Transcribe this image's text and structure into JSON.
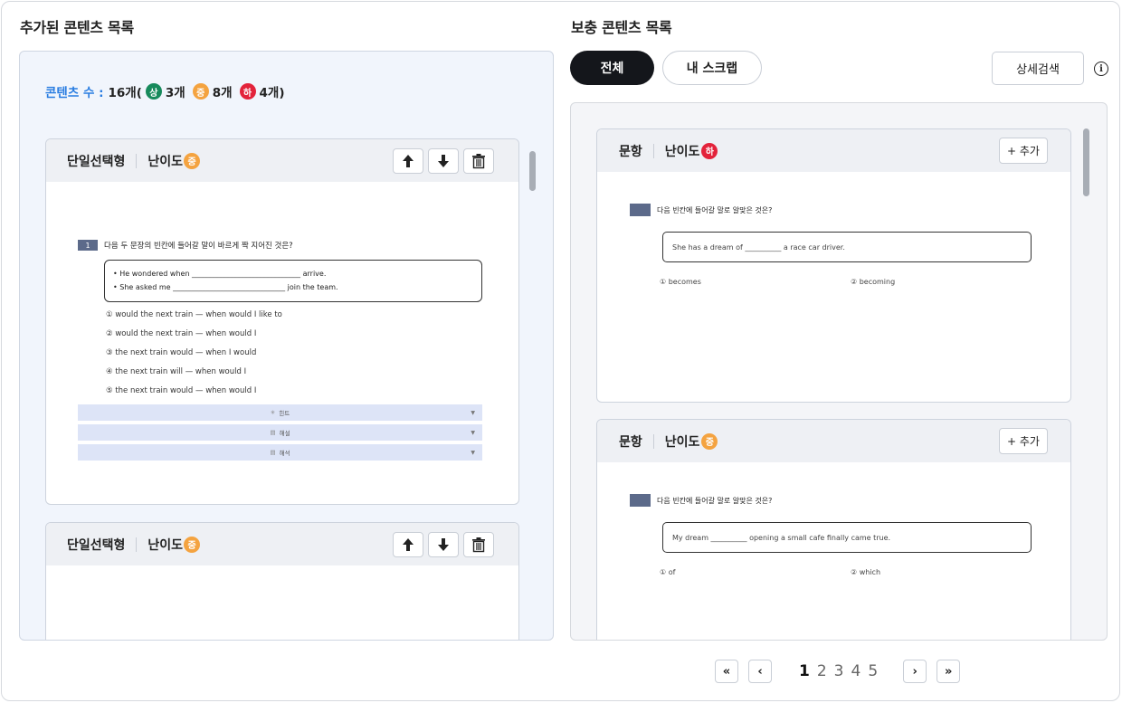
{
  "left": {
    "title": "추가된 콘텐츠 목록",
    "count_label": "콘텐츠 수 :",
    "count_total": "16개(",
    "badges": [
      {
        "letter": "상",
        "count": "3개"
      },
      {
        "letter": "중",
        "count": "8개"
      },
      {
        "letter": "하",
        "count": "4개)"
      }
    ],
    "cards": [
      {
        "type": "단일선택형",
        "difficulty_label": "난이도",
        "difficulty": "중",
        "question_no": "1",
        "question": "다음 두 문장의 빈칸에 들어갈 말이 바르게 짝 지어진 것은?",
        "box_lines": [
          "He wondered when ______________________________ arrive.",
          "She asked me _______________________________ join the team."
        ],
        "options": [
          "① would the next train — when would I like to",
          "② would the next train — when would I",
          "③ the next train would — when I would",
          "④ the next train will — when would I",
          "⑤ the next train would — when would I"
        ],
        "accordions": [
          "힌트",
          "해설",
          "해석"
        ]
      },
      {
        "type": "단일선택형",
        "difficulty_label": "난이도",
        "difficulty": "중"
      }
    ]
  },
  "right": {
    "title": "보충 콘텐츠 목록",
    "tabs": [
      "전체",
      "내 스크랩"
    ],
    "detail_search": "상세검색",
    "info_icon": "i",
    "add_label": "+ 추가",
    "cards": [
      {
        "type": "문항",
        "difficulty_label": "난이도",
        "difficulty": "하",
        "question": "다음 빈칸에 들어갈 말로 알맞은 것은?",
        "sentence": "She has a dream of __________ a race car driver.",
        "options": [
          "① becomes",
          "② becoming"
        ]
      },
      {
        "type": "문항",
        "difficulty_label": "난이도",
        "difficulty": "중",
        "question": "다음 빈칸에 들어갈 말로 알맞은 것은?",
        "sentence": "My dream __________ opening a small cafe finally came true.",
        "options": [
          "① of",
          "② which"
        ]
      }
    ]
  },
  "pagination": {
    "pages": [
      "1",
      "2",
      "3",
      "4",
      "5"
    ],
    "current": "1",
    "first": "«",
    "prev": "‹",
    "next": "›",
    "last": "»"
  }
}
